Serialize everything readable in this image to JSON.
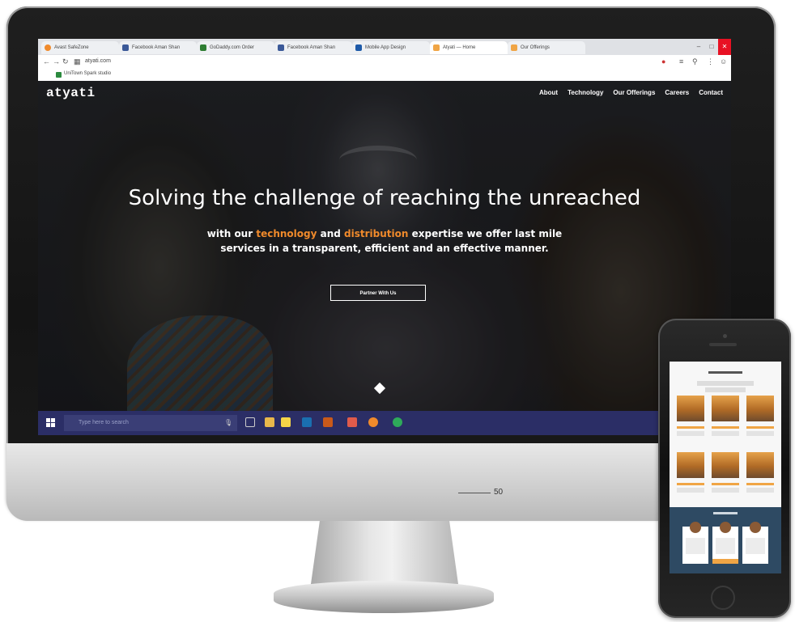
{
  "browser": {
    "tabs": [
      {
        "label": "Avast SafeZone",
        "color": "#f08a2b"
      },
      {
        "label": "Facebook Aman Shan",
        "color": "#3b5998"
      },
      {
        "label": "GoDaddy.com Order",
        "color": "#2e7d32"
      },
      {
        "label": "Facebook Aman Shan",
        "color": "#3b5998"
      },
      {
        "label": "Mobile App Design",
        "color": "#1e5aa8"
      },
      {
        "label": "Atyati — Home",
        "color": "#f0a545"
      },
      {
        "label": "Our Offerings",
        "color": "#f0a545"
      }
    ],
    "url": "atyati.com",
    "bookmark": "UniTown Spark studio"
  },
  "site": {
    "brand": "atyati",
    "nav": [
      "About",
      "Technology",
      "Our Offerings",
      "Careers",
      "Contact"
    ],
    "headline": "Solving the challenge of reaching the unreached",
    "sub_prefix": "with our",
    "sub_hl1": "technology",
    "sub_and": "and",
    "sub_hl2": "distribution",
    "sub_rest": "expertise we offer last mile",
    "sub_line2": "services in a transparent, efficient and an effective manner.",
    "cta": "Partner With Us",
    "accent": "#f08a2b"
  },
  "taskbar": {
    "search_placeholder": "Type here to search",
    "color": "#2b2e66"
  },
  "page_number": "50"
}
